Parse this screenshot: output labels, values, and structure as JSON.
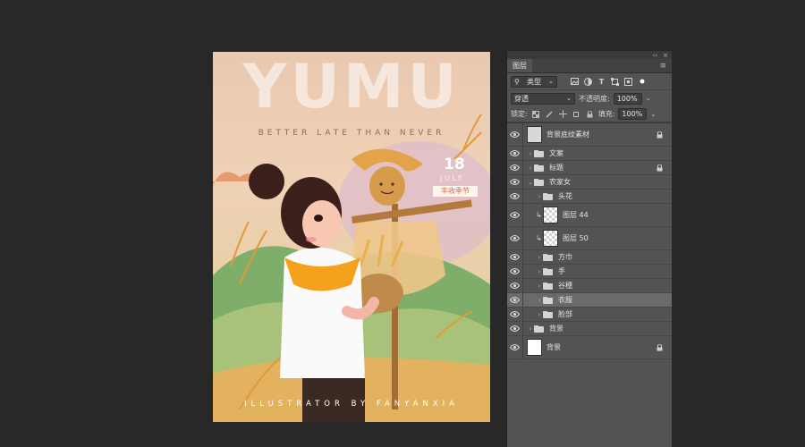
{
  "canvas": {
    "title": "YUMU",
    "tagline": "BETTER LATE THAN NEVER",
    "date_number": "18",
    "date_month": "JULY",
    "season_label": "丰收季节",
    "footer": "ILLUSTRATOR BY FANYANXIA"
  },
  "panel": {
    "tab_label": "图层",
    "collapse_glyph": "‹‹",
    "close_glyph": "×",
    "menu_glyph": "≡",
    "filter": {
      "type_label": "类型",
      "icons": [
        "image-filter-icon",
        "adjustment-filter-icon",
        "type-filter-icon",
        "shape-filter-icon",
        "smart-object-filter-icon",
        "filter-toggle-icon"
      ]
    },
    "blend_mode": "穿透",
    "opacity_label": "不透明度:",
    "opacity_value": "100%",
    "lock_label": "锁定:",
    "fill_label": "填充:",
    "fill_value": "100%"
  },
  "layers": [
    {
      "name": "背景底纹素材",
      "kind": "texture",
      "level": 0,
      "locked": true,
      "expand": ""
    },
    {
      "name": "文案",
      "kind": "group",
      "level": 0,
      "locked": false,
      "expand": "›"
    },
    {
      "name": "标题",
      "kind": "group",
      "level": 0,
      "locked": true,
      "expand": "›"
    },
    {
      "name": "农家女",
      "kind": "group",
      "level": 0,
      "locked": false,
      "expand": "⌄"
    },
    {
      "name": "头花",
      "kind": "group",
      "level": 1,
      "locked": false,
      "expand": "›"
    },
    {
      "name": "图层 44",
      "kind": "layer",
      "level": 1,
      "locked": false,
      "expand": ""
    },
    {
      "name": "图层 50",
      "kind": "layer",
      "level": 1,
      "locked": false,
      "expand": ""
    },
    {
      "name": "方巾",
      "kind": "group",
      "level": 1,
      "locked": false,
      "expand": "›"
    },
    {
      "name": "手",
      "kind": "group",
      "level": 1,
      "locked": false,
      "expand": "›"
    },
    {
      "name": "谷穗",
      "kind": "group",
      "level": 1,
      "locked": false,
      "expand": "›"
    },
    {
      "name": "衣服",
      "kind": "group",
      "level": 1,
      "locked": false,
      "expand": "›",
      "selected": true
    },
    {
      "name": "脸部",
      "kind": "group",
      "level": 1,
      "locked": false,
      "expand": "›"
    },
    {
      "name": "背景",
      "kind": "group",
      "level": 0,
      "locked": false,
      "expand": "›"
    },
    {
      "name": "背景",
      "kind": "background",
      "level": 0,
      "locked": true,
      "expand": ""
    }
  ]
}
